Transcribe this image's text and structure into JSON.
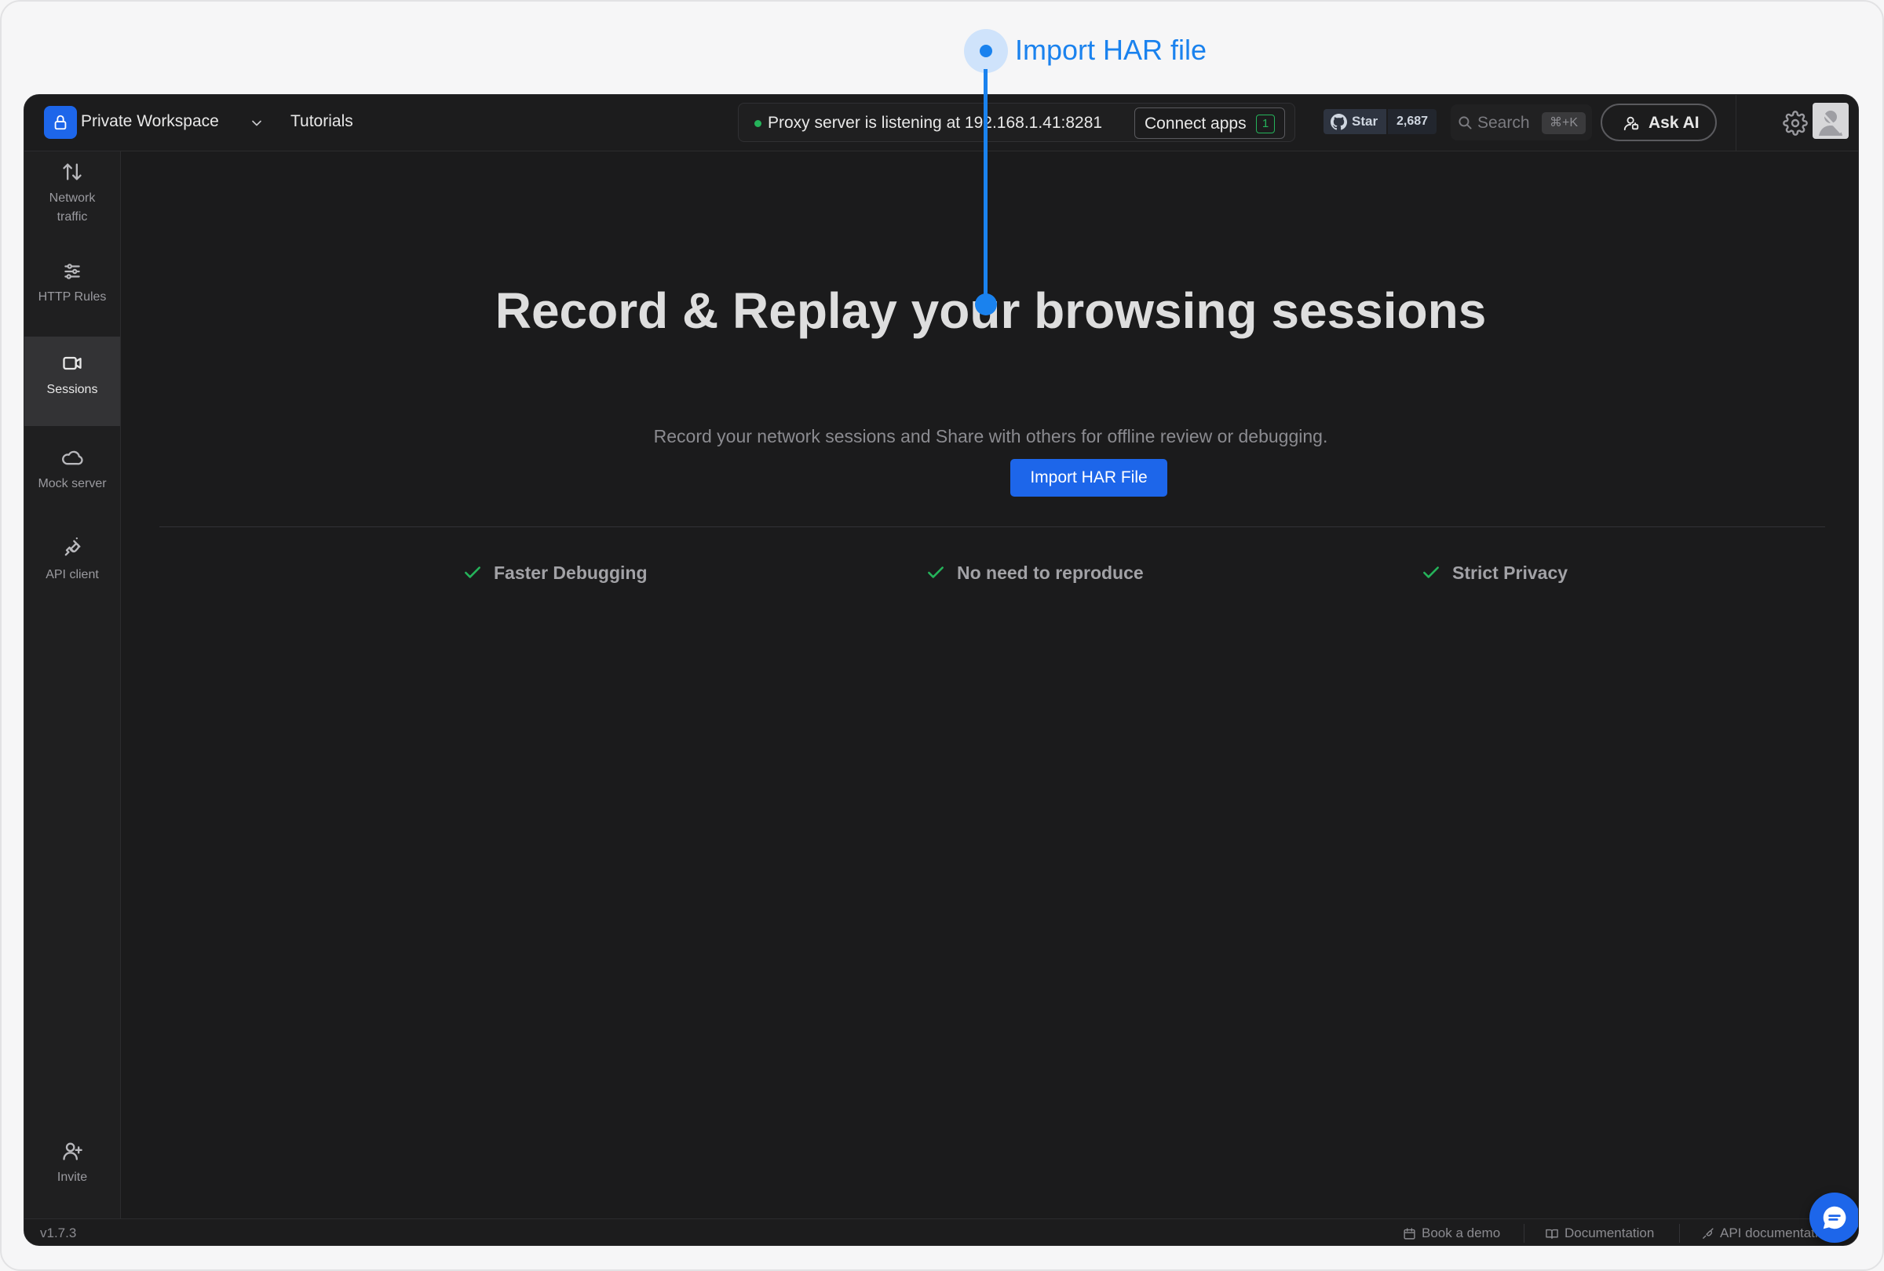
{
  "callout": {
    "label": "Import HAR file"
  },
  "topbar": {
    "workspace_name": "Private Workspace",
    "tutorials": "Tutorials",
    "proxy_status": "Proxy server is listening at 192.168.1.41:8281",
    "connect_apps": "Connect apps",
    "connect_apps_count": "1",
    "github_star": "Star",
    "github_count": "2,687",
    "search_label": "Search",
    "search_shortcut": "⌘+K",
    "ask_ai": "Ask AI"
  },
  "sidebar": {
    "items": [
      {
        "label": "Network traffic",
        "icon": "arrows-up-down-icon",
        "active": false
      },
      {
        "label": "HTTP Rules",
        "icon": "sliders-icon",
        "active": false
      },
      {
        "label": "Sessions",
        "icon": "video-camera-icon",
        "active": true
      },
      {
        "label": "Mock server",
        "icon": "cloud-icon",
        "active": false
      },
      {
        "label": "API client",
        "icon": "plug-icon",
        "active": false
      }
    ],
    "invite": "Invite"
  },
  "main": {
    "title": "Record & Replay your browsing sessions",
    "subtitle": "Record your network sessions and Share with others for offline review or debugging.",
    "import_button": "Import HAR File",
    "features": [
      "Faster Debugging",
      "No need to reproduce",
      "Strict Privacy"
    ]
  },
  "footer": {
    "version": "v1.7.3",
    "links": [
      "Book a demo",
      "Documentation",
      "API documentation"
    ]
  },
  "colors": {
    "accent": "#1d66ea",
    "callout": "#1a82ee",
    "success": "#25b35a",
    "background": "#1b1b1c"
  }
}
